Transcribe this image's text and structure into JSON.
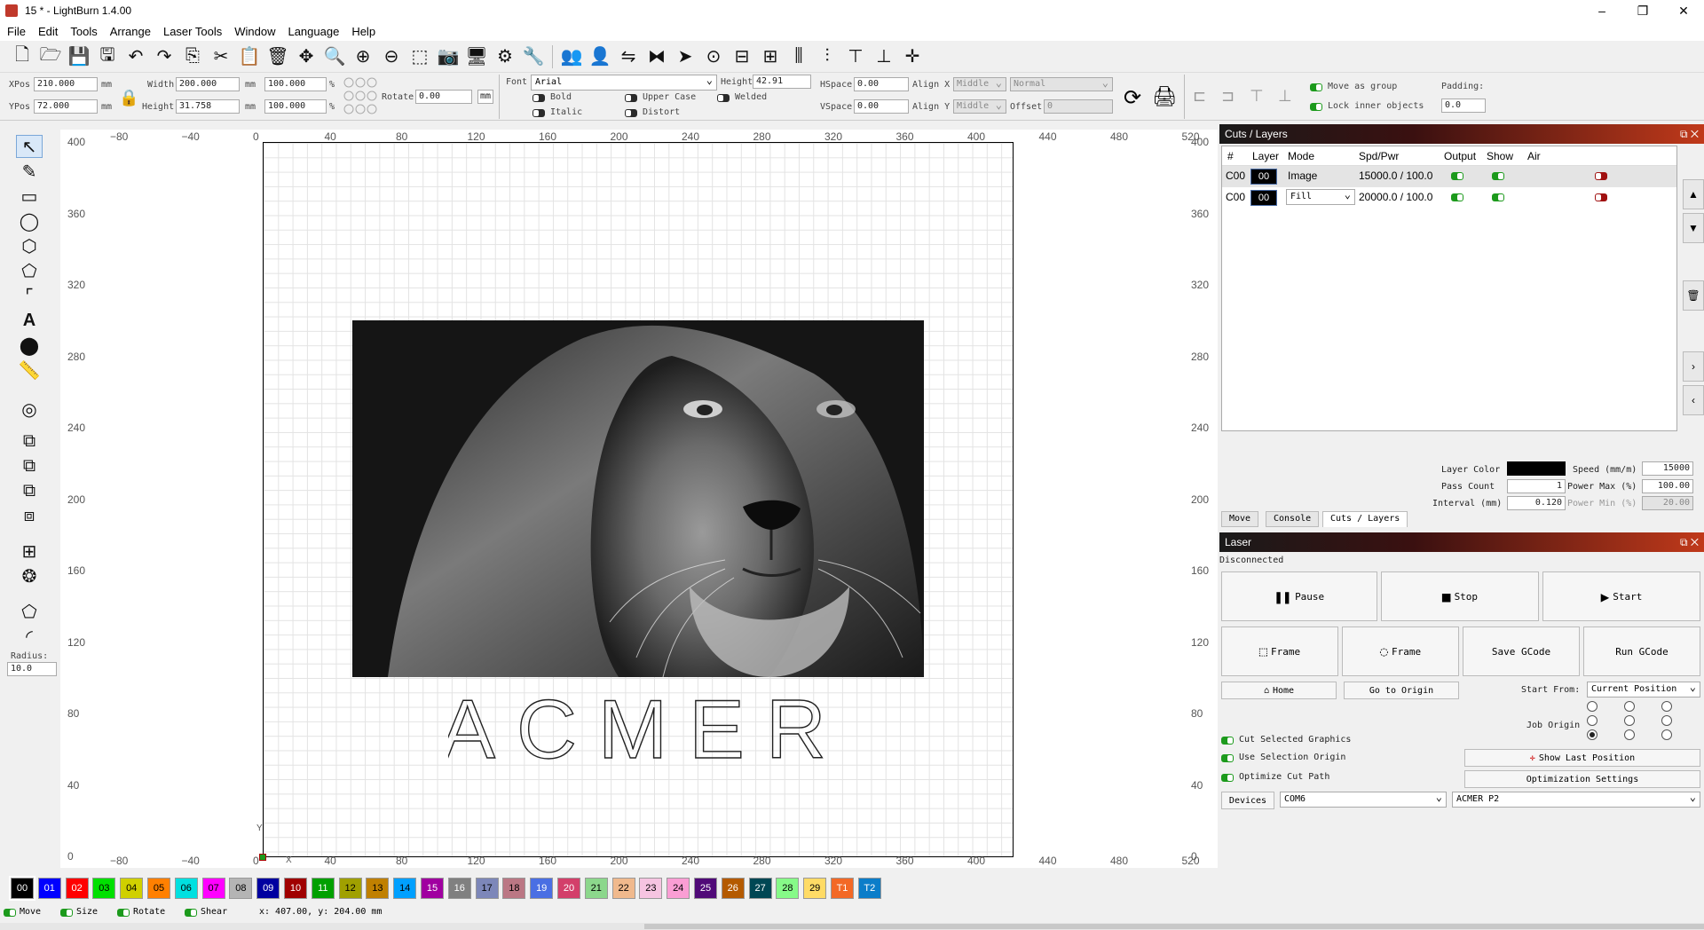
{
  "window": {
    "title": "15 * - LightBurn 1.4.00",
    "minimize": "–",
    "maximize": "❐",
    "close": "✕"
  },
  "menu": [
    "File",
    "Edit",
    "Tools",
    "Arrange",
    "Laser Tools",
    "Window",
    "Language",
    "Help"
  ],
  "props": {
    "xpos_label": "XPos",
    "xpos": "210.000",
    "ypos_label": "YPos",
    "ypos": "72.000",
    "width_label": "Width",
    "width": "200.000",
    "height_label": "Height",
    "height": "31.758",
    "unit": "mm",
    "pct1": "100.000",
    "pct2": "100.000",
    "pct": "%",
    "rotate_label": "Rotate",
    "rotate": "0.00",
    "mm_btn": "mm",
    "font_label": "Font",
    "font": "Arial",
    "fheight_label": "Height",
    "fheight": "42.91",
    "bold": "Bold",
    "italic": "Italic",
    "upper": "Upper Case",
    "distort": "Distort",
    "welded": "Welded",
    "hspace_label": "HSpace",
    "hspace": "0.00",
    "vspace_label": "VSpace",
    "vspace": "0.00",
    "alignx_label": "Align X",
    "alignx": "Middle",
    "aligny_label": "Align Y",
    "aligny": "Middle",
    "normal": "Normal",
    "offset_label": "Offset",
    "offset": "0",
    "move_group": "Move as group",
    "lock_inner": "Lock inner objects",
    "padding_label": "Padding:",
    "padding": "0.0"
  },
  "ruler": {
    "top": [
      "−80",
      "−40",
      "0",
      "40",
      "80",
      "120",
      "160",
      "200",
      "240",
      "280",
      "320",
      "360",
      "400",
      "440",
      "480",
      "520"
    ],
    "left": [
      "400",
      "360",
      "320",
      "280",
      "240",
      "200",
      "160",
      "120",
      "80",
      "40",
      "0"
    ],
    "bottom": [
      "−80",
      "−40",
      "0",
      "40",
      "80",
      "120",
      "160",
      "200",
      "240",
      "280",
      "320",
      "360",
      "400",
      "440",
      "480",
      "520"
    ],
    "right": [
      "400",
      "360",
      "320",
      "280",
      "240",
      "200",
      "160",
      "120",
      "80",
      "40",
      "0"
    ]
  },
  "canvas": {
    "text": "ACMER",
    "axis_x": "X",
    "axis_y": "Y"
  },
  "radius": {
    "label": "Radius:",
    "value": "10.0"
  },
  "cuts": {
    "title": "Cuts / Layers",
    "headers": [
      "#",
      "Layer",
      "Mode",
      "Spd/Pwr",
      "Output",
      "Show",
      "Air"
    ],
    "rows": [
      {
        "num": "C00",
        "layer": "00",
        "mode": "Image",
        "spdpwr": "15000.0 / 100.0"
      },
      {
        "num": "C00",
        "layer": "00",
        "mode": "Fill",
        "spdpwr": "20000.0 / 100.0"
      }
    ],
    "layer_color_label": "Layer Color",
    "pass_count_label": "Pass Count",
    "pass_count": "1",
    "interval_label": "Interval (mm)",
    "interval": "0.120",
    "speed_label": "Speed (mm/m)",
    "speed": "15000",
    "pmax_label": "Power Max (%)",
    "pmax": "100.00",
    "pmin_label": "Power Min (%)",
    "pmin": "20.00",
    "tabs": [
      "Move",
      "Console",
      "Cuts / Layers"
    ]
  },
  "laser": {
    "title": "Laser",
    "status": "Disconnected",
    "pause": "Pause",
    "stop": "Stop",
    "start": "Start",
    "frame1": "Frame",
    "frame2": "Frame",
    "save_gcode": "Save GCode",
    "run_gcode": "Run GCode",
    "home": "Home",
    "go_origin": "Go to Origin",
    "start_from_label": "Start From:",
    "start_from": "Current Position",
    "job_origin": "Job Origin",
    "cut_selected": "Cut Selected Graphics",
    "use_sel_origin": "Use Selection Origin",
    "optimize": "Optimize Cut Path",
    "show_last": "Show Last Position",
    "opt_settings": "Optimization Settings",
    "devices": "Devices",
    "port": "COM6",
    "device": "ACMER P2"
  },
  "palette": [
    "00",
    "01",
    "02",
    "03",
    "04",
    "05",
    "06",
    "07",
    "08",
    "09",
    "10",
    "11",
    "12",
    "13",
    "14",
    "15",
    "16",
    "17",
    "18",
    "19",
    "20",
    "21",
    "22",
    "23",
    "24",
    "25",
    "26",
    "27",
    "28",
    "29",
    "T1",
    "T2"
  ],
  "palette_colors": [
    "#000000",
    "#0000ff",
    "#ff0000",
    "#00e000",
    "#d0d000",
    "#ff8000",
    "#00e0e0",
    "#ff00ff",
    "#b4b4b4",
    "#0000a0",
    "#a00000",
    "#00a000",
    "#a0a000",
    "#c08000",
    "#00a0ff",
    "#a000a0",
    "#808080",
    "#7d87b9",
    "#bb7784",
    "#4a6fe3",
    "#d33f6a",
    "#8cd78c",
    "#f0b98d",
    "#f6c4e1",
    "#fa9ed4",
    "#500a78",
    "#b45a00",
    "#004754",
    "#86fa88",
    "#ffdb66",
    "#f36926",
    "#0b7dc9"
  ],
  "status": {
    "move": "Move",
    "size": "Size",
    "rotate": "Rotate",
    "shear": "Shear",
    "coords": "x: 407.00, y: 204.00 mm"
  }
}
